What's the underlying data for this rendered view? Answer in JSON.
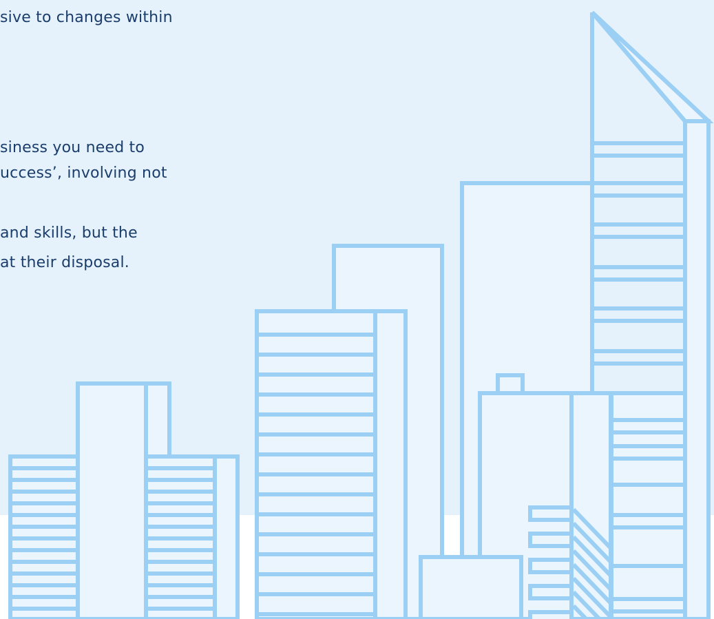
{
  "paragraph_1": {
    "lines": [
      "sive to changes within"
    ]
  },
  "paragraph_2": {
    "lines": [
      "siness you need to",
      "uccess’, involving not",
      " and skills, but the",
      "at their disposal."
    ]
  },
  "colors": {
    "panel_background": "#e5f2fc",
    "text": "#1b3d6b",
    "skyline_stroke": "#9ccff4",
    "skyline_fill": "#eaf5fd"
  },
  "illustration": {
    "icon": "city-skyline-illustration"
  }
}
